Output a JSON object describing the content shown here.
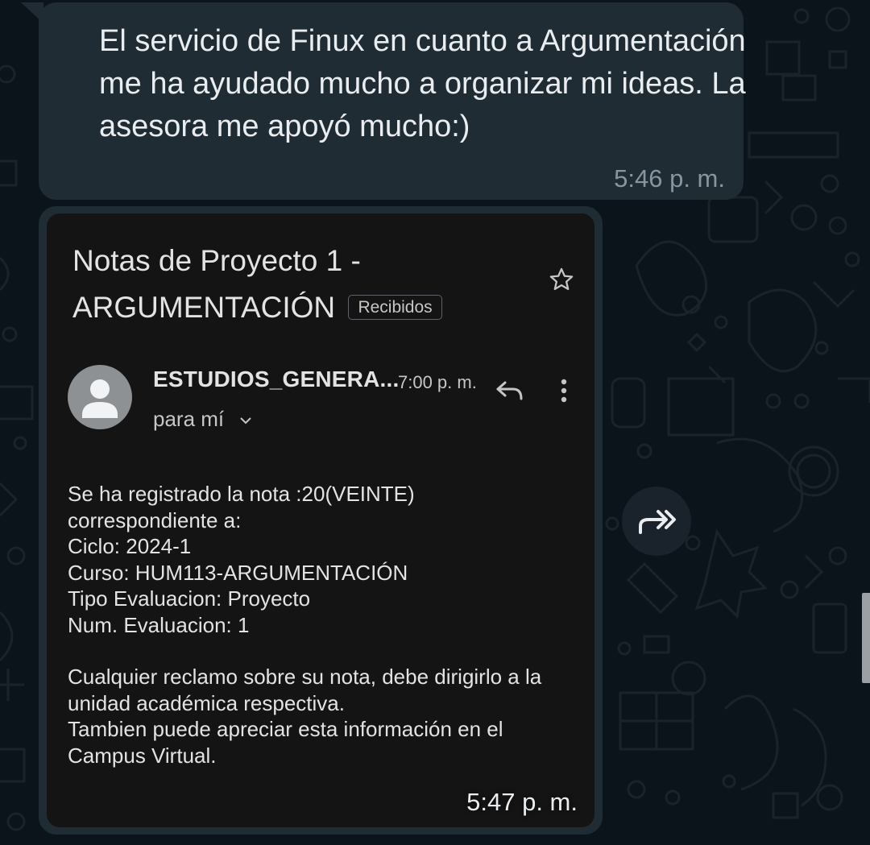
{
  "message": {
    "text": "El servicio de Finux en cuanto a Argumentación me ha ayudado mucho a organizar mi ideas. La asesora me apoyó mucho:)",
    "time": "5:46 p. m."
  },
  "image_message": {
    "time": "5:47 p. m.",
    "email": {
      "subject": "Notas de Proyecto 1 - ARGUMENTACIÓN",
      "label_badge": "Recibidos",
      "sender": "ESTUDIOS_GENERA...",
      "sent_time": "7:00 p. m.",
      "recipient": "para mí",
      "body": [
        "Se ha registrado la nota :20(VEINTE)",
        "correspondiente a:",
        "Ciclo: 2024-1",
        "Curso: HUM113-ARGUMENTACIÓN",
        "Tipo Evaluacion: Proyecto",
        "Num. Evaluacion: 1",
        "",
        "Cualquier reclamo sobre su nota, debe dirigirlo a la",
        "unidad académica respectiva.",
        "Tambien puede apreciar esta información en el",
        "Campus Virtual."
      ],
      "icons": [
        "star-icon",
        "avatar-person-icon",
        "reply-icon",
        "more-vert-icon",
        "chevron-down-icon"
      ]
    }
  },
  "actions": {
    "forward_icon": "forward-icon"
  },
  "colors": {
    "chat_background": "#0b141a",
    "bubble": "#202c33",
    "email_background": "#141414",
    "timestamp": "#8696a0",
    "text": "#e9edef"
  }
}
